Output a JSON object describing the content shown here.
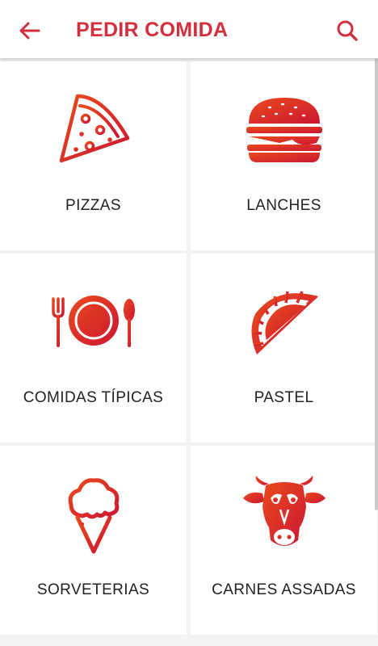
{
  "appbar": {
    "title": "PEDIR COMIDA",
    "back_icon": "arrow-left-icon",
    "search_icon": "search-icon"
  },
  "colors": {
    "accent": "#d32f3c",
    "gradient_start": "#e8401f",
    "gradient_end": "#c8182f"
  },
  "categories": [
    {
      "label": "PIZZAS",
      "icon": "pizza-icon"
    },
    {
      "label": "LANCHES",
      "icon": "burger-icon"
    },
    {
      "label": "COMIDAS TÍPICAS",
      "icon": "plate-cutlery-icon"
    },
    {
      "label": "PASTEL",
      "icon": "pastel-icon"
    },
    {
      "label": "SORVETERIAS",
      "icon": "ice-cream-icon"
    },
    {
      "label": "CARNES ASSADAS",
      "icon": "cow-icon"
    }
  ]
}
